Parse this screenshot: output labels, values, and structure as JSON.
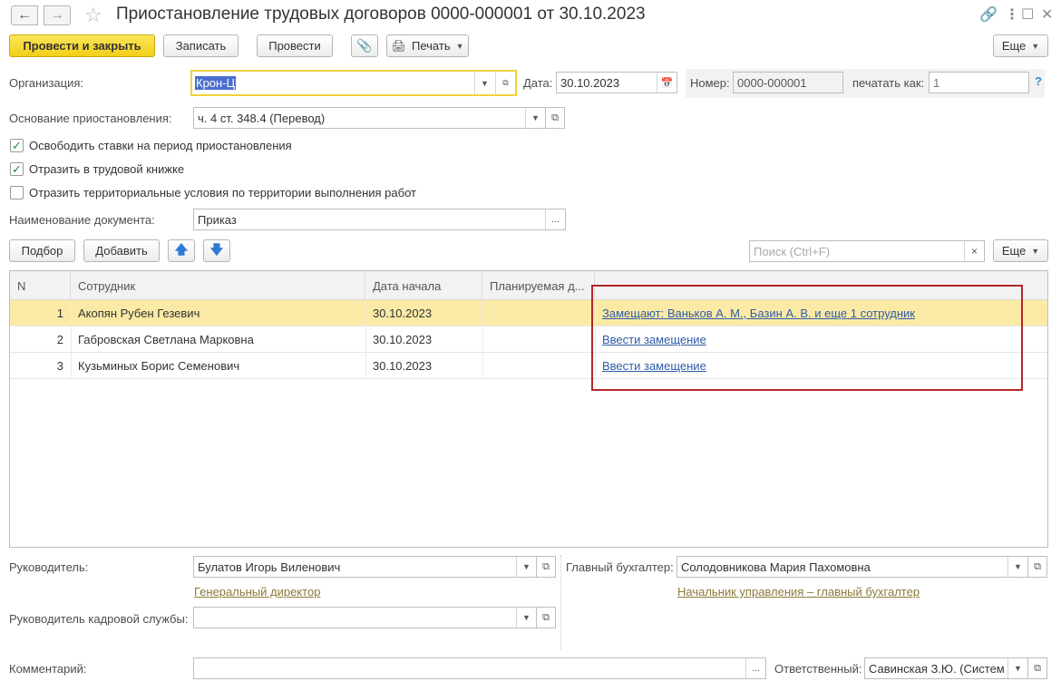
{
  "window": {
    "title": "Приостановление трудовых договоров 0000-000001 от 30.10.2023",
    "back_icon": "arrow-left-icon",
    "forward_icon": "arrow-right-icon",
    "favorite_icon": "star-icon",
    "link_icon": "link-icon",
    "menu_icon": "more-vertical-icon",
    "maximize_icon": "maximize-icon",
    "close_icon": "close-icon"
  },
  "toolbar": {
    "post_close_label": "Провести и закрыть",
    "save_label": "Записать",
    "post_label": "Провести",
    "print_label": "Печать",
    "more_label": "Еще"
  },
  "form": {
    "organization_label": "Организация:",
    "organization_value": "Крон-Ц",
    "date_label": "Дата:",
    "date_value": "30.10.2023",
    "number_label": "Номер:",
    "number_value": "0000-000001",
    "print_as_label": "печатать как:",
    "print_as_placeholder": "1",
    "help_label": "?",
    "basis_label": "Основание приостановления:",
    "basis_value": "ч. 4 ст. 348.4 (Перевод)",
    "checkbox_free_rates": {
      "label": "Освободить ставки на период приостановления",
      "checked": true
    },
    "checkbox_work_book": {
      "label": "Отразить в трудовой книжке",
      "checked": true
    },
    "checkbox_territorial": {
      "label": "Отразить территориальные условия по территории выполнения работ",
      "checked": false
    },
    "doc_name_label": "Наименование документа:",
    "doc_name_value": "Приказ"
  },
  "table_toolbar": {
    "pick_label": "Подбор",
    "add_label": "Добавить",
    "search_placeholder": "Поиск (Ctrl+F)",
    "search_clear": "×",
    "more_label": "Еще"
  },
  "table": {
    "columns": [
      "N",
      "Сотрудник",
      "Дата начала",
      "Планируемая д...",
      ""
    ],
    "rows": [
      {
        "n": "1",
        "employee": "Акопян Рубен Гезевич",
        "start": "30.10.2023",
        "planned": "",
        "action": "Замещают: Ваньков А. М., Базин А. В. и еще 1 сотрудник",
        "selected": true
      },
      {
        "n": "2",
        "employee": "Габровская Светлана Марковна",
        "start": "30.10.2023",
        "planned": "",
        "action": "Ввести замещение",
        "selected": false
      },
      {
        "n": "3",
        "employee": "Кузьминых Борис Семенович",
        "start": "30.10.2023",
        "planned": "",
        "action": "Ввести замещение",
        "selected": false
      }
    ],
    "highlight_color": "#b3262a",
    "selected_row_color": "#fbeaa6"
  },
  "footer": {
    "head_label": "Руководитель:",
    "head_value": "Булатов Игорь Виленович",
    "head_position": "Генеральный директор",
    "chief_accountant_label": "Главный бухгалтер:",
    "chief_accountant_value": "Солодовникова Мария Пахомовна",
    "chief_accountant_position": "Начальник управления – главный бухгалтер",
    "hr_head_label": "Руководитель кадровой службы:",
    "hr_head_value": "",
    "comment_label": "Комментарий:",
    "comment_value": "",
    "responsible_label": "Ответственный:",
    "responsible_value": "Савинская З.Ю. (Систем"
  },
  "colors": {
    "primary_button": "#f2cf17",
    "link": "#2f5ca8",
    "position_link": "#8a7a3a",
    "focus_border": "#f0d23a"
  }
}
